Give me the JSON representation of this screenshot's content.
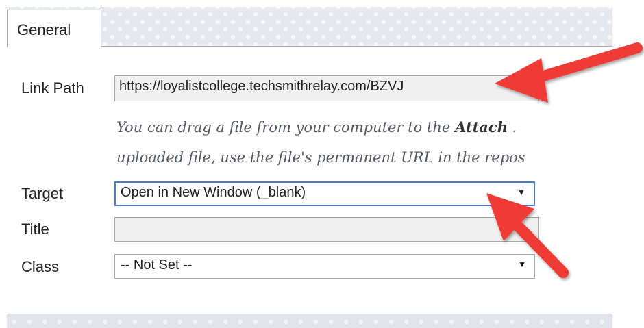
{
  "tabs": {
    "general_label": "General"
  },
  "link_path": {
    "label": "Link Path",
    "value": "https://loyalistcollege.techsmithrelay.com/BZVJ"
  },
  "hint": {
    "line1_prefix": "You can drag a file from your computer to the ",
    "line1_bold": "Attach",
    "line1_suffix": " .",
    "line2": "uploaded file, use the file's permanent URL in the repos"
  },
  "target": {
    "label": "Target",
    "selected": "Open in New Window (_blank)"
  },
  "title": {
    "label": "Title",
    "value": ""
  },
  "class": {
    "label": "Class",
    "selected": "-- Not Set --"
  },
  "colors": {
    "arrow": "#ef3b36",
    "focus_border": "#4a79d4"
  },
  "icons": {
    "dropdown": "▼"
  }
}
